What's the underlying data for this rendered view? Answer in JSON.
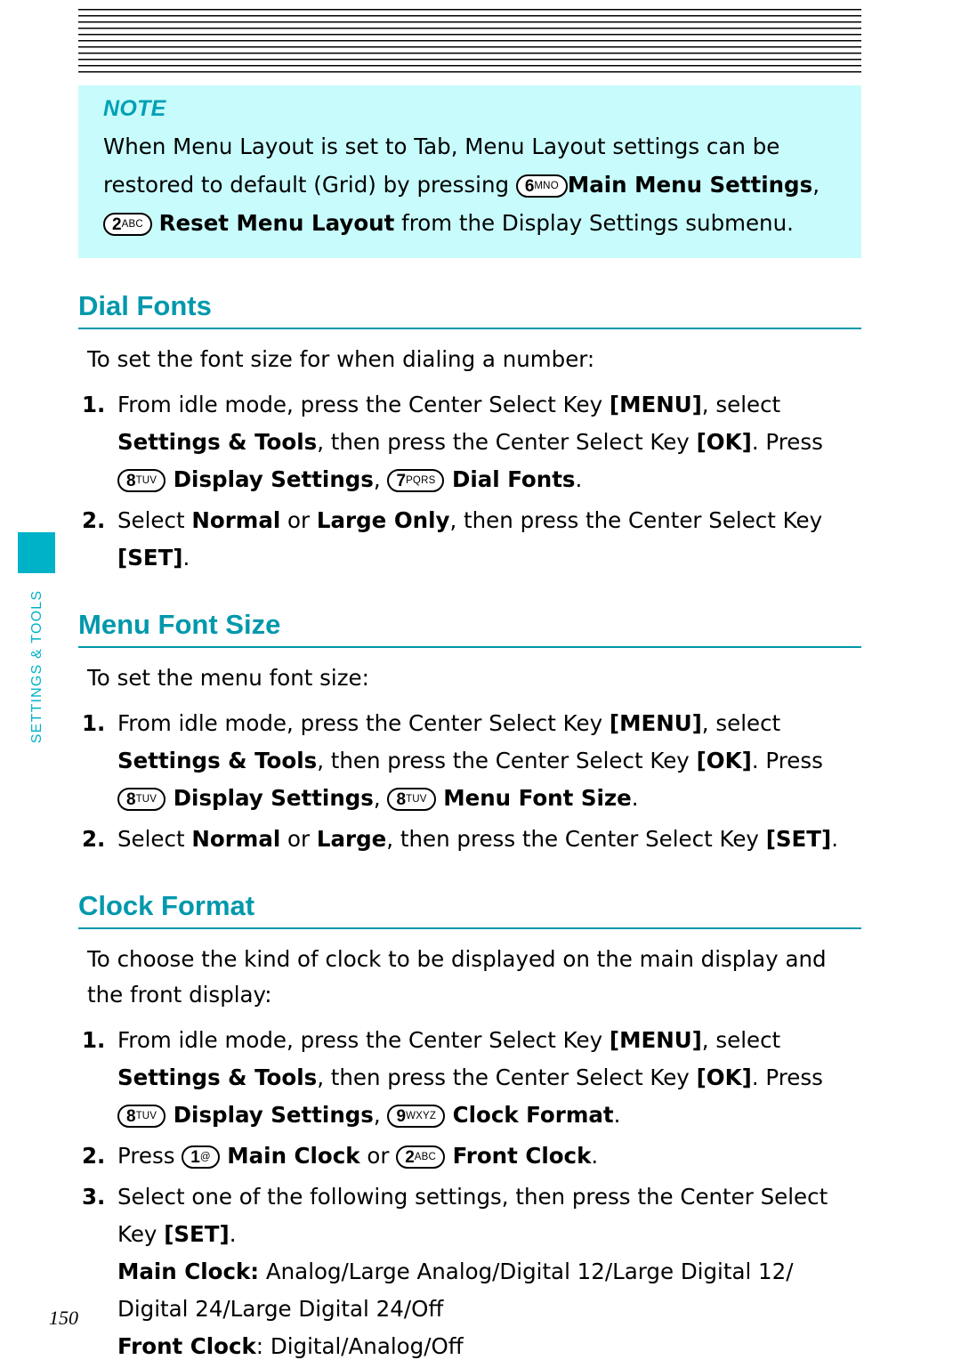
{
  "page": {
    "number": "150",
    "side_tab_label": "SETTINGS & TOOLS",
    "accent_color": "#0098ac",
    "note_bg_color": "#c8fcfc"
  },
  "note": {
    "title": "NOTE",
    "line1_a": "When Menu Layout is set to Tab, Menu Layout settings can be",
    "line2_a": "restored to default (Grid) by pressing ",
    "key_6": {
      "digit": "6",
      "letters": "MNO"
    },
    "line2_b": "Main Menu Settings",
    "line2_c": ",",
    "key_2": {
      "digit": "2",
      "letters": "ABC"
    },
    "line3_a": "Reset Menu Layout",
    "line3_b": " from the Display Settings submenu."
  },
  "sections": [
    {
      "heading": "Dial Fonts",
      "intro": "To set the font size for when dialing a number:",
      "steps": [
        {
          "num": "1.",
          "parts": [
            {
              "t": "From idle mode, press the Center Select Key ",
              "b": false
            },
            {
              "t": "[MENU]",
              "b": true
            },
            {
              "t": ", select ",
              "b": false
            },
            {
              "t": "Settings & Tools",
              "b": true
            },
            {
              "t": ", then press the Center Select Key ",
              "b": false
            },
            {
              "t": "[OK]",
              "b": true
            },
            {
              "t": ". Press ",
              "b": false
            },
            {
              "key": {
                "digit": "8",
                "letters": "TUV"
              }
            },
            {
              "t": " Display Settings",
              "b": true
            },
            {
              "t": ", ",
              "b": false
            },
            {
              "key": {
                "digit": "7",
                "letters": "PQRS"
              }
            },
            {
              "t": " Dial Fonts",
              "b": true
            },
            {
              "t": ".",
              "b": false
            }
          ]
        },
        {
          "num": "2.",
          "parts": [
            {
              "t": "Select ",
              "b": false
            },
            {
              "t": "Normal",
              "b": true
            },
            {
              "t": " or ",
              "b": false
            },
            {
              "t": "Large Only",
              "b": true
            },
            {
              "t": ", then press the Center Select Key ",
              "b": false
            },
            {
              "t": "[SET]",
              "b": true
            },
            {
              "t": ".",
              "b": false
            }
          ]
        }
      ]
    },
    {
      "heading": "Menu Font Size",
      "intro": "To set the menu font size:",
      "steps": [
        {
          "num": "1.",
          "parts": [
            {
              "t": "From idle mode, press the Center Select Key ",
              "b": false
            },
            {
              "t": "[MENU]",
              "b": true
            },
            {
              "t": ", select ",
              "b": false
            },
            {
              "t": "Settings & Tools",
              "b": true
            },
            {
              "t": ", then press the Center Select Key ",
              "b": false
            },
            {
              "t": "[OK]",
              "b": true
            },
            {
              "t": ". Press ",
              "b": false
            },
            {
              "key": {
                "digit": "8",
                "letters": "TUV"
              }
            },
            {
              "t": " Display Settings",
              "b": true
            },
            {
              "t": ", ",
              "b": false
            },
            {
              "key": {
                "digit": "8",
                "letters": "TUV"
              }
            },
            {
              "t": " Menu Font Size",
              "b": true
            },
            {
              "t": ".",
              "b": false
            }
          ]
        },
        {
          "num": "2.",
          "parts": [
            {
              "t": "Select ",
              "b": false
            },
            {
              "t": "Normal",
              "b": true
            },
            {
              "t": " or ",
              "b": false
            },
            {
              "t": "Large",
              "b": true
            },
            {
              "t": ", then press the Center Select Key ",
              "b": false
            },
            {
              "t": "[SET]",
              "b": true
            },
            {
              "t": ".",
              "b": false
            }
          ]
        }
      ]
    },
    {
      "heading": "Clock Format",
      "intro": "To choose the kind of clock to be displayed on the main display and the front display:",
      "steps": [
        {
          "num": "1.",
          "parts": [
            {
              "t": "From idle mode, press the Center Select Key ",
              "b": false
            },
            {
              "t": "[MENU]",
              "b": true
            },
            {
              "t": ", select ",
              "b": false
            },
            {
              "t": "Settings & Tools",
              "b": true
            },
            {
              "t": ", then press the Center Select Key ",
              "b": false
            },
            {
              "t": "[OK]",
              "b": true
            },
            {
              "t": ". Press ",
              "b": false
            },
            {
              "key": {
                "digit": "8",
                "letters": "TUV"
              }
            },
            {
              "t": " Display Settings",
              "b": true
            },
            {
              "t": ", ",
              "b": false
            },
            {
              "key": {
                "digit": "9",
                "letters": "WXYZ"
              }
            },
            {
              "t": " Clock Format",
              "b": true
            },
            {
              "t": ".",
              "b": false
            }
          ]
        },
        {
          "num": "2.",
          "parts": [
            {
              "t": "Press ",
              "b": false
            },
            {
              "key": {
                "digit": "1",
                "letters": "@"
              }
            },
            {
              "t": " Main Clock",
              "b": true
            },
            {
              "t": " or ",
              "b": false
            },
            {
              "key": {
                "digit": "2",
                "letters": "ABC"
              }
            },
            {
              "t": " Front Clock",
              "b": true
            },
            {
              "t": ".",
              "b": false
            }
          ]
        },
        {
          "num": "3.",
          "parts": [
            {
              "t": "Select one of the following settings, then press the Center Select Key ",
              "b": false
            },
            {
              "t": "[SET]",
              "b": true
            },
            {
              "t": ".",
              "b": false
            },
            {
              "br": true
            },
            {
              "t": "Main Clock:",
              "b": true
            },
            {
              "t": " Analog/Large Analog/Digital 12/Large Digital 12/ Digital 24/Large Digital 24/Off",
              "b": false
            },
            {
              "br": true
            },
            {
              "t": "Front Clock",
              "b": true
            },
            {
              "t": ": Digital/Analog/Off",
              "b": false
            }
          ]
        }
      ]
    }
  ]
}
